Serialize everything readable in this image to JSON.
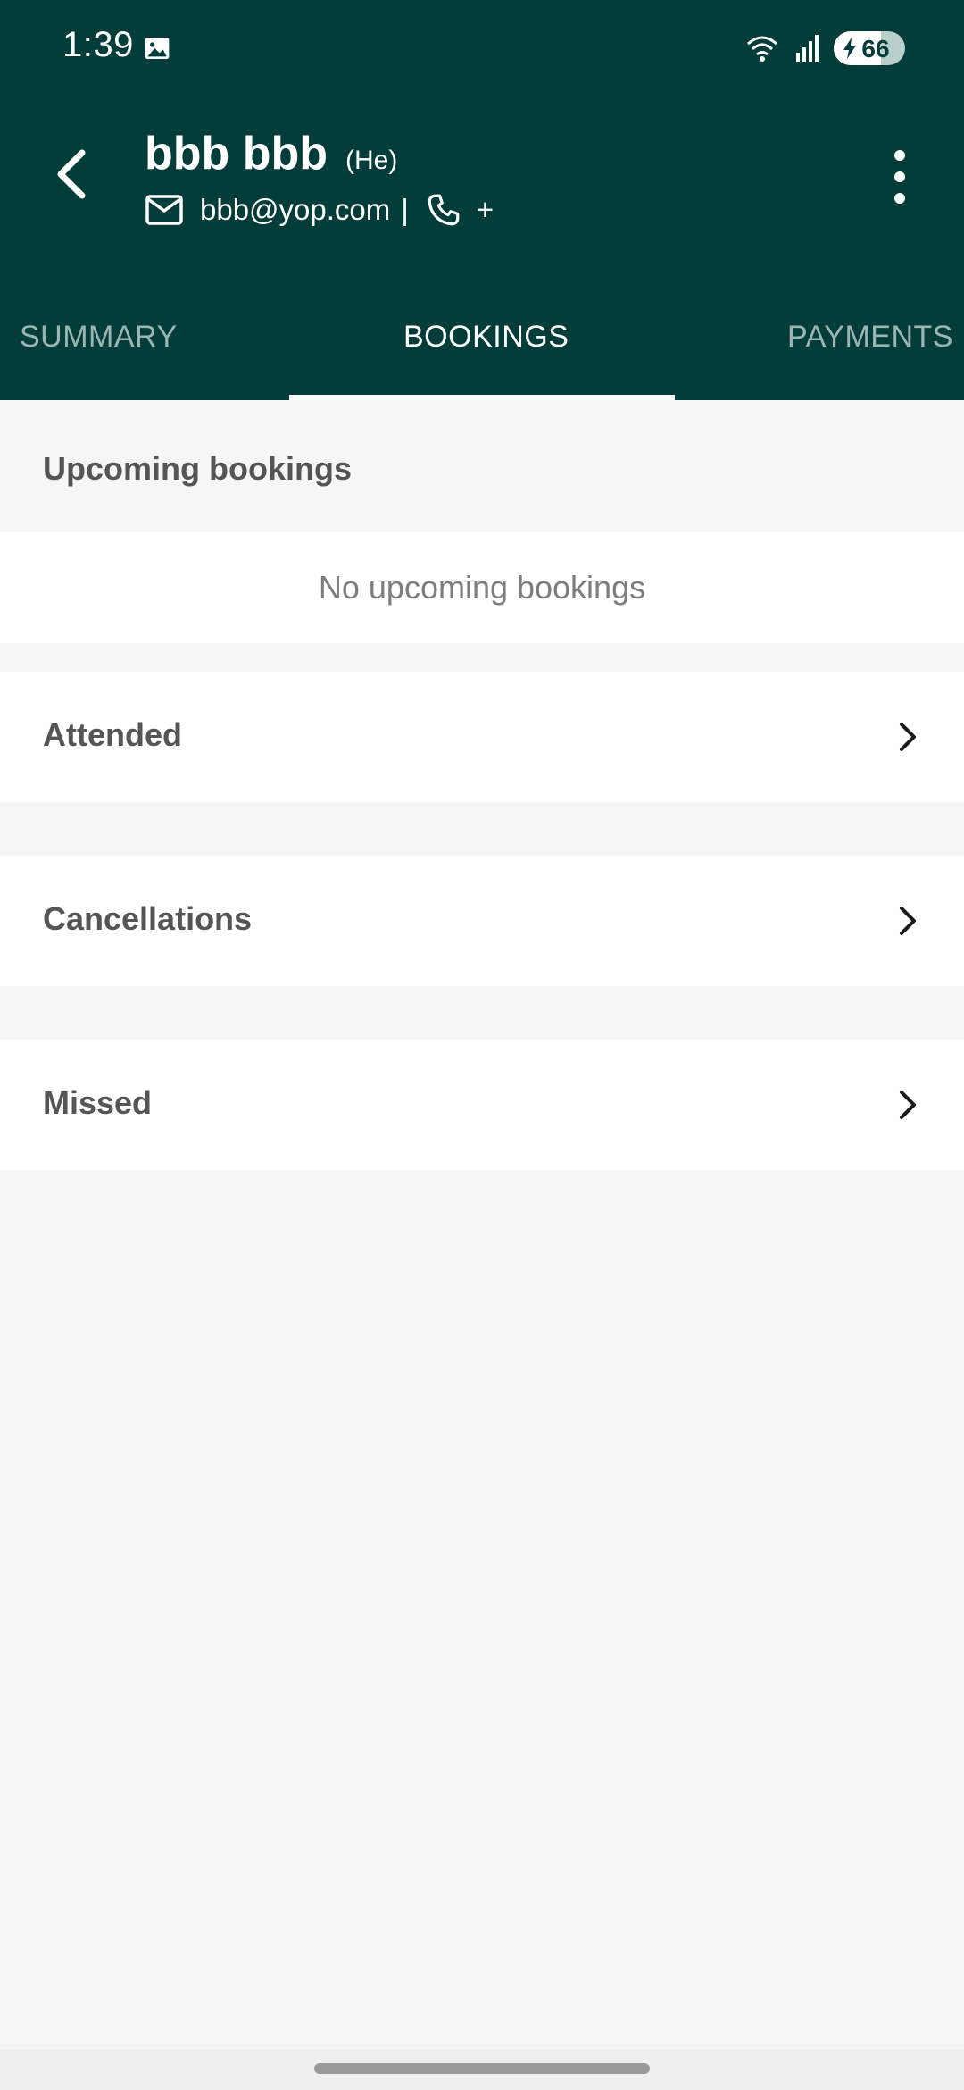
{
  "status_bar": {
    "time": "1:39",
    "battery": "66"
  },
  "header": {
    "name": "bbb bbb",
    "pronoun": "(He)",
    "email": "bbb@yop.com",
    "separator": "|",
    "phone": "+"
  },
  "tabs": [
    {
      "label": "SUMMARY"
    },
    {
      "label": "BOOKINGS"
    },
    {
      "label": "PAYMENTS"
    }
  ],
  "upcoming": {
    "title": "Upcoming bookings",
    "empty_text": "No upcoming bookings"
  },
  "rows": [
    {
      "label": "Attended"
    },
    {
      "label": "Cancellations"
    },
    {
      "label": "Missed"
    }
  ],
  "colors": {
    "header_bg": "#033d3a",
    "body_bg": "#f6f6f6"
  }
}
